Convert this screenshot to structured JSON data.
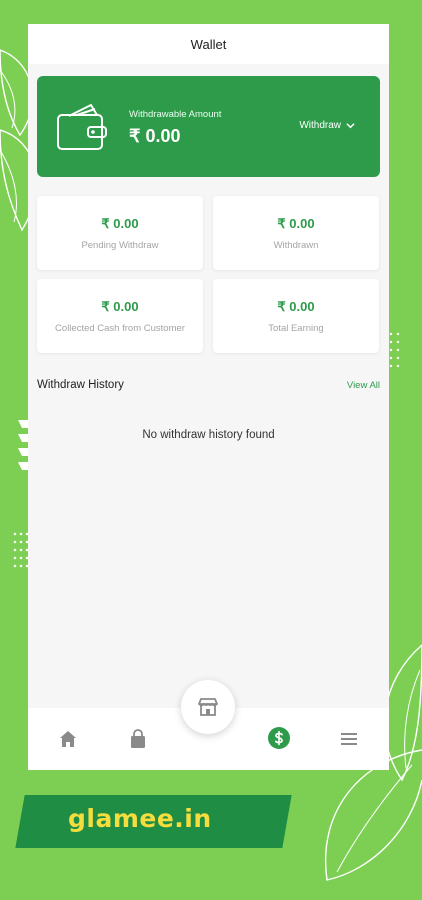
{
  "header": {
    "title": "Wallet"
  },
  "balance": {
    "label": "Withdrawable Amount",
    "amount": "₹ 0.00",
    "withdraw_label": "Withdraw",
    "icon": "wallet-icon"
  },
  "stats": [
    {
      "value": "₹ 0.00",
      "label": "Pending Withdraw"
    },
    {
      "value": "₹ 0.00",
      "label": "Withdrawn"
    },
    {
      "value": "₹ 0.00",
      "label": "Collected Cash from Customer"
    },
    {
      "value": "₹ 0.00",
      "label": "Total Earning"
    }
  ],
  "history": {
    "title": "Withdraw History",
    "view_all": "View All",
    "empty_message": "No withdraw history found"
  },
  "nav": {
    "items": [
      "home-icon",
      "shopping-bag-icon",
      "store-icon",
      "dollar-icon",
      "menu-icon"
    ],
    "active": "dollar-icon"
  },
  "brand": {
    "text": "glamee.in"
  },
  "colors": {
    "background": "#7ccf52",
    "primary": "#2e9b4b",
    "brand_banner": "#208d44",
    "brand_text": "#f4dd3c",
    "nav_inactive": "#8a8a8a"
  }
}
